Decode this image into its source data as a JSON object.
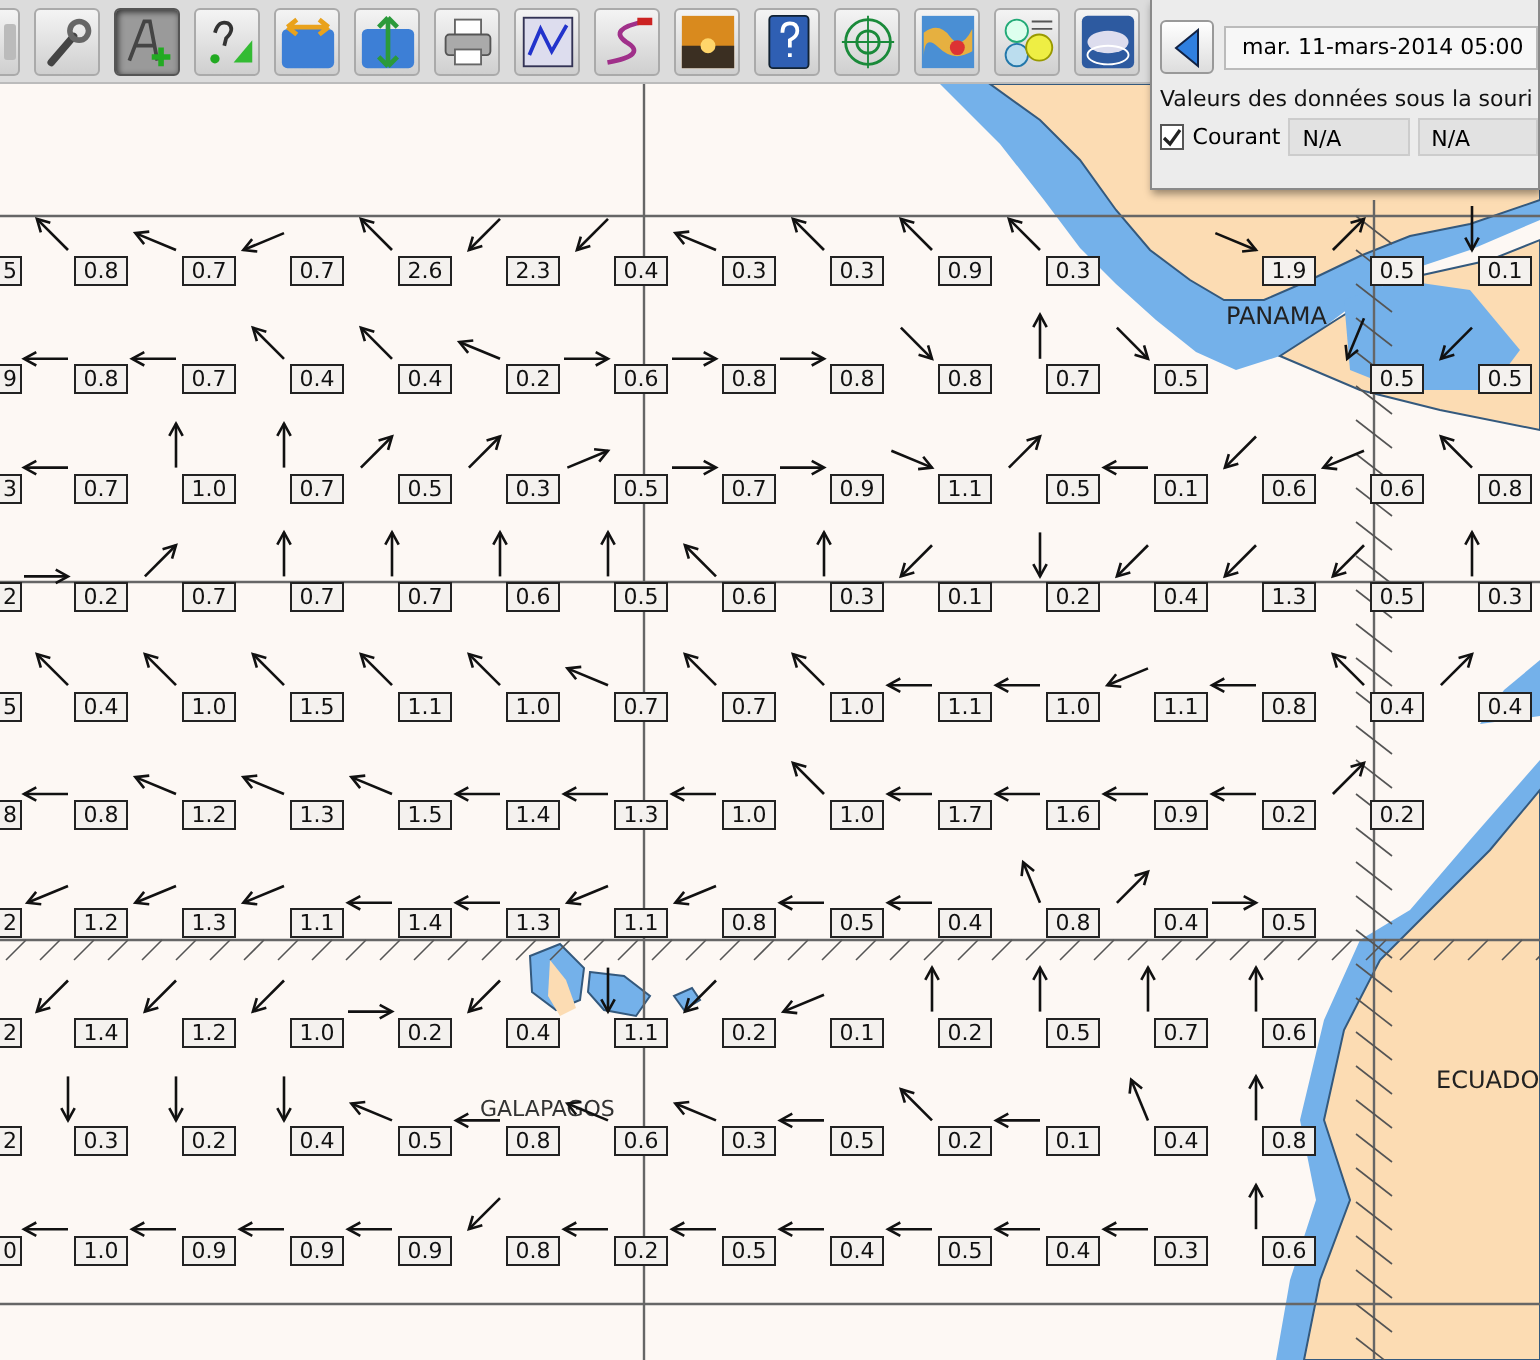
{
  "toolbar": [
    {
      "kind": "partial",
      "selected": false
    },
    {
      "kind": "wrench",
      "selected": false
    },
    {
      "kind": "text-add",
      "selected": true
    },
    {
      "kind": "query",
      "selected": false
    },
    {
      "kind": "stretch-h",
      "selected": false
    },
    {
      "kind": "stretch-v",
      "selected": false
    },
    {
      "kind": "printer",
      "selected": false
    },
    {
      "kind": "chart",
      "selected": false
    },
    {
      "kind": "curve",
      "selected": false
    },
    {
      "kind": "sunset",
      "selected": false
    },
    {
      "kind": "help",
      "selected": false
    },
    {
      "kind": "target",
      "selected": false
    },
    {
      "kind": "weather",
      "selected": false
    },
    {
      "kind": "gauges",
      "selected": false
    },
    {
      "kind": "ge2kap",
      "selected": false
    }
  ],
  "panel": {
    "date": "mar. 11-mars-2014 05:00",
    "group_title": "Valeurs des données sous la souri",
    "layers": [
      {
        "label": "Courant",
        "checked": true,
        "values": [
          "N/A",
          "N/A"
        ]
      }
    ]
  },
  "map": {
    "place_names": [
      {
        "name": "PANAMA",
        "kind": "country"
      },
      {
        "name": "GALAPAGOS",
        "kind": "islands"
      },
      {
        "name": "ECUADO",
        "kind": "country"
      }
    ],
    "rows": [
      {
        "cells": [
          {
            "kind": "edge",
            "value": "5"
          },
          {
            "kind": "NW",
            "value": "0.8"
          },
          {
            "kind": "WNW",
            "value": "0.7"
          },
          {
            "kind": "WSW",
            "value": "0.7"
          },
          {
            "kind": "NW",
            "value": "2.6"
          },
          {
            "kind": "SW",
            "value": "2.3"
          },
          {
            "kind": "SW",
            "value": "0.4"
          },
          {
            "kind": "WNW",
            "value": "0.3"
          },
          {
            "kind": "NW",
            "value": "0.3"
          },
          {
            "kind": "NW",
            "value": "0.9"
          },
          {
            "kind": "NW",
            "value": "0.3"
          },
          {
            "kind": "gap"
          },
          {
            "kind": "ESE",
            "value": "1.9"
          },
          {
            "kind": "NE",
            "value": "0.5"
          },
          {
            "kind": "S",
            "value": "0.1"
          }
        ]
      },
      {
        "cells": [
          {
            "kind": "edge",
            "value": "9"
          },
          {
            "kind": "W",
            "value": "0.8"
          },
          {
            "kind": "W",
            "value": "0.7"
          },
          {
            "kind": "NW",
            "value": "0.4"
          },
          {
            "kind": "NW",
            "value": "0.4"
          },
          {
            "kind": "WNW",
            "value": "0.2"
          },
          {
            "kind": "E",
            "value": "0.6"
          },
          {
            "kind": "E",
            "value": "0.8"
          },
          {
            "kind": "E",
            "value": "0.8"
          },
          {
            "kind": "SE",
            "value": "0.8"
          },
          {
            "kind": "N",
            "value": "0.7"
          },
          {
            "kind": "SE",
            "value": "0.5"
          },
          {
            "kind": "gap"
          },
          {
            "kind": "SSW",
            "value": "0.5"
          },
          {
            "kind": "SW",
            "value": "0.5"
          }
        ]
      },
      {
        "cells": [
          {
            "kind": "edge",
            "value": "3"
          },
          {
            "kind": "W",
            "value": "0.7"
          },
          {
            "kind": "N",
            "value": "1.0"
          },
          {
            "kind": "N",
            "value": "0.7"
          },
          {
            "kind": "NE",
            "value": "0.5"
          },
          {
            "kind": "NE",
            "value": "0.3"
          },
          {
            "kind": "ENE",
            "value": "0.5"
          },
          {
            "kind": "E",
            "value": "0.7"
          },
          {
            "kind": "E",
            "value": "0.9"
          },
          {
            "kind": "ESE",
            "value": "1.1"
          },
          {
            "kind": "NE",
            "value": "0.5"
          },
          {
            "kind": "W",
            "value": "0.1"
          },
          {
            "kind": "SW",
            "value": "0.6"
          },
          {
            "kind": "WSW",
            "value": "0.6"
          },
          {
            "kind": "NW",
            "value": "0.8"
          }
        ]
      },
      {
        "cells": [
          {
            "kind": "edge",
            "value": "2"
          },
          {
            "kind": "E",
            "value": "0.2"
          },
          {
            "kind": "NE",
            "value": "0.7"
          },
          {
            "kind": "N",
            "value": "0.7"
          },
          {
            "kind": "N",
            "value": "0.7"
          },
          {
            "kind": "N",
            "value": "0.6"
          },
          {
            "kind": "N",
            "value": "0.5"
          },
          {
            "kind": "NW",
            "value": "0.6"
          },
          {
            "kind": "N",
            "value": "0.3"
          },
          {
            "kind": "SW",
            "value": "0.1"
          },
          {
            "kind": "S",
            "value": "0.2"
          },
          {
            "kind": "SW",
            "value": "0.4"
          },
          {
            "kind": "SW",
            "value": "1.3"
          },
          {
            "kind": "SW",
            "value": "0.5"
          },
          {
            "kind": "N",
            "value": "0.3"
          }
        ]
      },
      {
        "cells": [
          {
            "kind": "edge",
            "value": "5"
          },
          {
            "kind": "NW",
            "value": "0.4"
          },
          {
            "kind": "NW",
            "value": "1.0"
          },
          {
            "kind": "NW",
            "value": "1.5"
          },
          {
            "kind": "NW",
            "value": "1.1"
          },
          {
            "kind": "NW",
            "value": "1.0"
          },
          {
            "kind": "WNW",
            "value": "0.7"
          },
          {
            "kind": "NW",
            "value": "0.7"
          },
          {
            "kind": "NW",
            "value": "1.0"
          },
          {
            "kind": "W",
            "value": "1.1"
          },
          {
            "kind": "W",
            "value": "1.0"
          },
          {
            "kind": "WSW",
            "value": "1.1"
          },
          {
            "kind": "W",
            "value": "0.8"
          },
          {
            "kind": "NW",
            "value": "0.4"
          },
          {
            "kind": "NE",
            "value": "0.4"
          }
        ]
      },
      {
        "cells": [
          {
            "kind": "edge",
            "value": "8"
          },
          {
            "kind": "W",
            "value": "0.8"
          },
          {
            "kind": "WNW",
            "value": "1.2"
          },
          {
            "kind": "WNW",
            "value": "1.3"
          },
          {
            "kind": "WNW",
            "value": "1.5"
          },
          {
            "kind": "W",
            "value": "1.4"
          },
          {
            "kind": "W",
            "value": "1.3"
          },
          {
            "kind": "W",
            "value": "1.0"
          },
          {
            "kind": "NW",
            "value": "1.0"
          },
          {
            "kind": "W",
            "value": "1.7"
          },
          {
            "kind": "W",
            "value": "1.6"
          },
          {
            "kind": "W",
            "value": "0.9"
          },
          {
            "kind": "W",
            "value": "0.2"
          },
          {
            "kind": "NE",
            "value": "0.2"
          }
        ]
      },
      {
        "cells": [
          {
            "kind": "edge",
            "value": "2"
          },
          {
            "kind": "WSW",
            "value": "1.2"
          },
          {
            "kind": "WSW",
            "value": "1.3"
          },
          {
            "kind": "WSW",
            "value": "1.1"
          },
          {
            "kind": "W",
            "value": "1.4"
          },
          {
            "kind": "W",
            "value": "1.3"
          },
          {
            "kind": "WSW",
            "value": "1.1"
          },
          {
            "kind": "WSW",
            "value": "0.8"
          },
          {
            "kind": "W",
            "value": "0.5"
          },
          {
            "kind": "W",
            "value": "0.4"
          },
          {
            "kind": "NNW",
            "value": "0.8"
          },
          {
            "kind": "NE",
            "value": "0.4"
          },
          {
            "kind": "E",
            "value": "0.5"
          }
        ]
      },
      {
        "cells": [
          {
            "kind": "edge",
            "value": "2"
          },
          {
            "kind": "SW",
            "value": "1.4"
          },
          {
            "kind": "SW",
            "value": "1.2"
          },
          {
            "kind": "SW",
            "value": "1.0"
          },
          {
            "kind": "E",
            "value": "0.2"
          },
          {
            "kind": "SW",
            "value": "0.4"
          },
          {
            "kind": "S",
            "value": "1.1"
          },
          {
            "kind": "SW",
            "value": "0.2"
          },
          {
            "kind": "WSW",
            "value": "0.1"
          },
          {
            "kind": "N",
            "value": "0.2"
          },
          {
            "kind": "N",
            "value": "0.5"
          },
          {
            "kind": "N",
            "value": "0.7"
          },
          {
            "kind": "N",
            "value": "0.6"
          }
        ]
      },
      {
        "cells": [
          {
            "kind": "edge",
            "value": "2"
          },
          {
            "kind": "S",
            "value": "0.3"
          },
          {
            "kind": "S",
            "value": "0.2"
          },
          {
            "kind": "S",
            "value": "0.4"
          },
          {
            "kind": "WNW",
            "value": "0.5"
          },
          {
            "kind": "W",
            "value": "0.8"
          },
          {
            "kind": "WNW",
            "value": "0.6"
          },
          {
            "kind": "WNW",
            "value": "0.3"
          },
          {
            "kind": "W",
            "value": "0.5"
          },
          {
            "kind": "NW",
            "value": "0.2"
          },
          {
            "kind": "W",
            "value": "0.1"
          },
          {
            "kind": "NNW",
            "value": "0.4"
          },
          {
            "kind": "N",
            "value": "0.8"
          }
        ]
      },
      {
        "cells": [
          {
            "kind": "edge",
            "value": "0"
          },
          {
            "kind": "W",
            "value": "1.0"
          },
          {
            "kind": "W",
            "value": "0.9"
          },
          {
            "kind": "W",
            "value": "0.9"
          },
          {
            "kind": "W",
            "value": "0.9"
          },
          {
            "kind": "SW",
            "value": "0.8"
          },
          {
            "kind": "W",
            "value": "0.2"
          },
          {
            "kind": "W",
            "value": "0.5"
          },
          {
            "kind": "W",
            "value": "0.4"
          },
          {
            "kind": "W",
            "value": "0.5"
          },
          {
            "kind": "W",
            "value": "0.4"
          },
          {
            "kind": "W",
            "value": "0.3"
          },
          {
            "kind": "N",
            "value": "0.6"
          }
        ]
      }
    ]
  }
}
